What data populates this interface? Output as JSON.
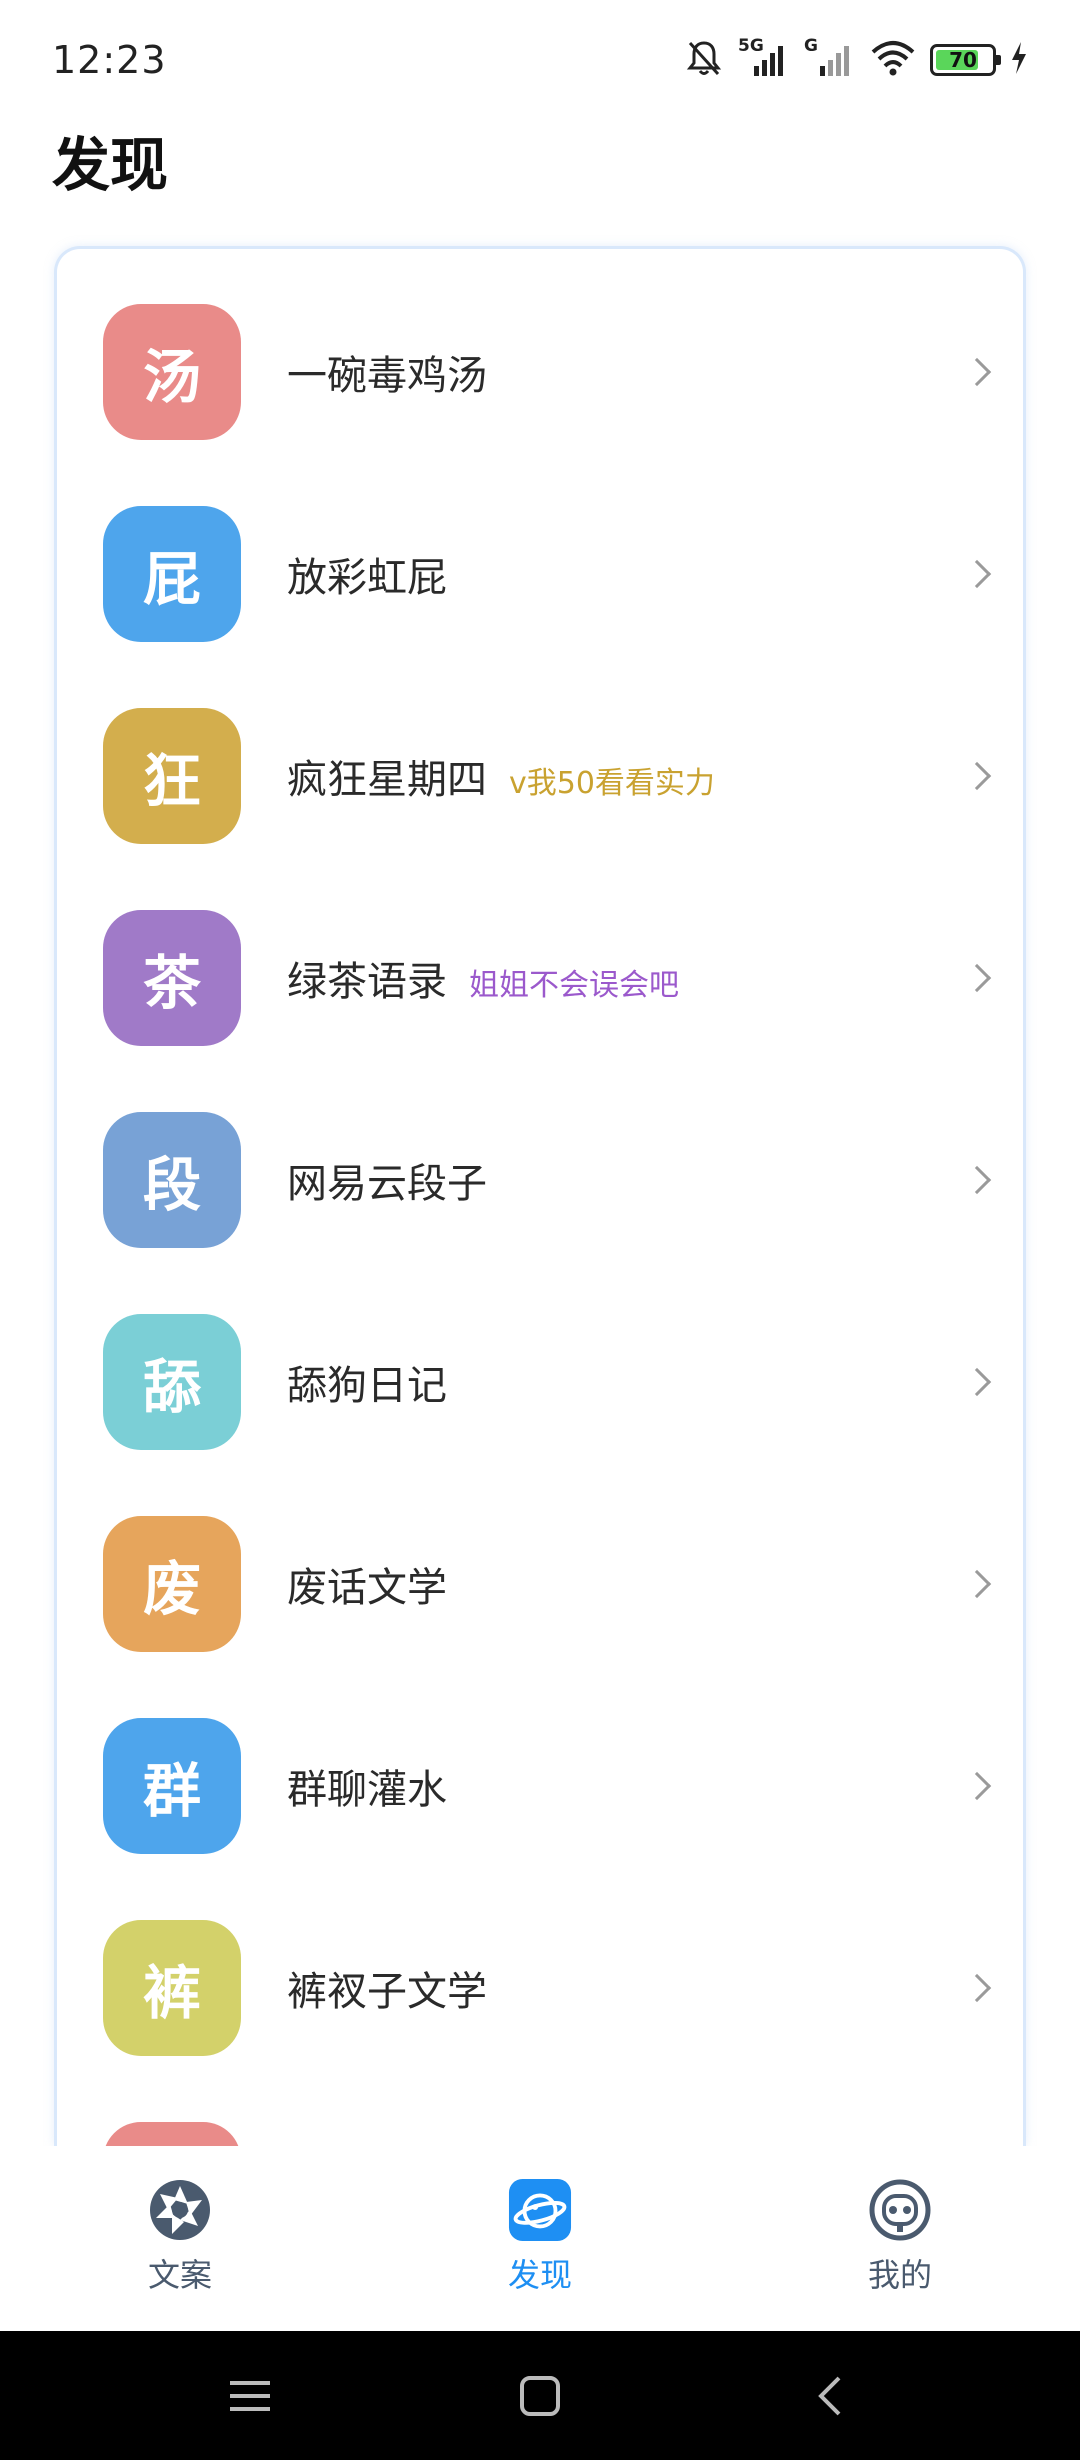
{
  "status_bar": {
    "time": "12:23",
    "network_label_1": "5G",
    "network_label_2": "G",
    "battery_level": "70",
    "battery_color": "#5ad65a"
  },
  "page_title": "发现",
  "items": [
    {
      "badge": "汤",
      "label": "一碗毒鸡汤",
      "subtitle": "",
      "color": "#e98b89",
      "subtitle_color": ""
    },
    {
      "badge": "屁",
      "label": "放彩虹屁",
      "subtitle": "",
      "color": "#4ea5ec",
      "subtitle_color": ""
    },
    {
      "badge": "狂",
      "label": "疯狂星期四",
      "subtitle": "v我50看看实力",
      "color": "#d3ae4d",
      "subtitle_color": "#c9a230"
    },
    {
      "badge": "茶",
      "label": "绿茶语录",
      "subtitle": "姐姐不会误会吧",
      "color": "#a07ac8",
      "subtitle_color": "#9b59cc"
    },
    {
      "badge": "段",
      "label": "网易云段子",
      "subtitle": "",
      "color": "#78a2d6",
      "subtitle_color": ""
    },
    {
      "badge": "舔",
      "label": "舔狗日记",
      "subtitle": "",
      "color": "#7bcfd6",
      "subtitle_color": ""
    },
    {
      "badge": "废",
      "label": "废话文学",
      "subtitle": "",
      "color": "#e6a55c",
      "subtitle_color": ""
    },
    {
      "badge": "群",
      "label": "群聊灌水",
      "subtitle": "",
      "color": "#4ea5ec",
      "subtitle_color": ""
    },
    {
      "badge": "裤",
      "label": "裤衩子文学",
      "subtitle": "",
      "color": "#d3d16a",
      "subtitle_color": ""
    },
    {
      "badge": "",
      "label": "",
      "subtitle": "",
      "color": "#e98b89",
      "subtitle_color": ""
    }
  ],
  "bottom_nav": [
    {
      "label": "文案",
      "icon": "aperture-icon",
      "active": false
    },
    {
      "label": "发现",
      "icon": "planet-icon",
      "active": true
    },
    {
      "label": "我的",
      "icon": "robot-face-icon",
      "active": false
    }
  ],
  "system_nav": [
    "menu-icon",
    "home-icon",
    "back-icon"
  ],
  "accent_color": "#1e8ff3"
}
